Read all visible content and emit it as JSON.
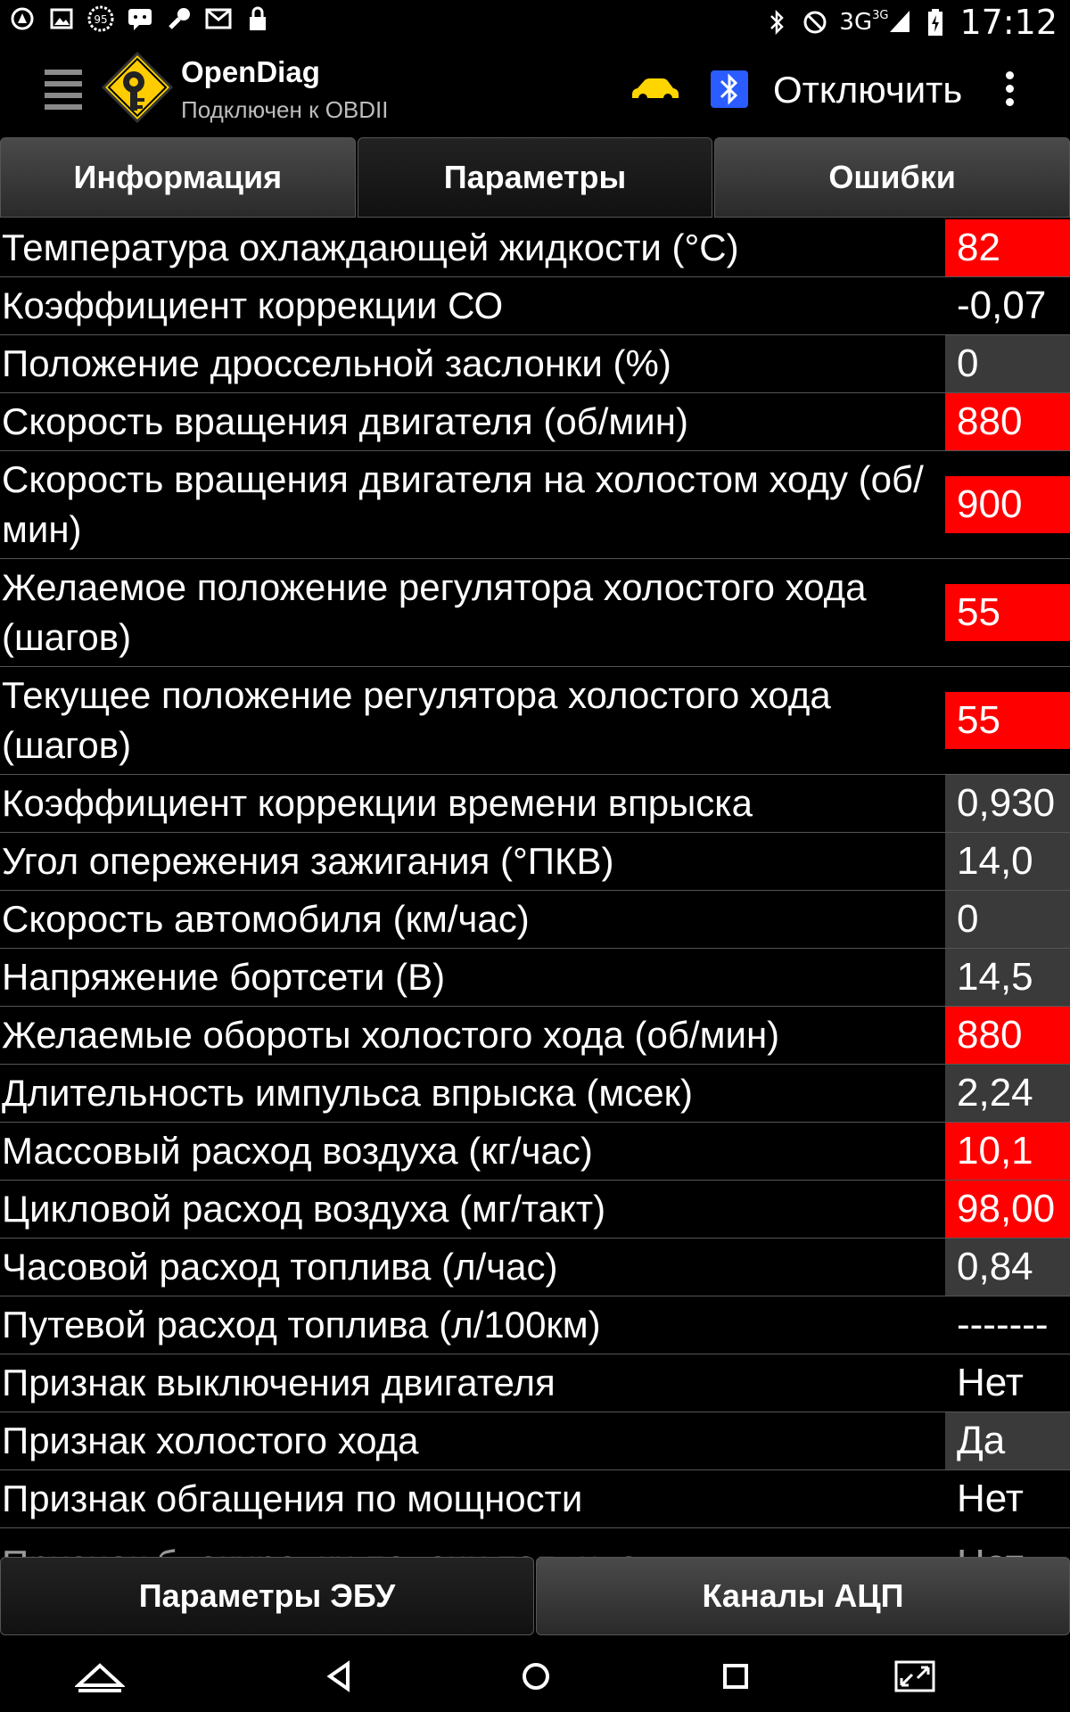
{
  "status_bar": {
    "network": "3G",
    "network_sup": "3G",
    "time": "17:12",
    "badge": "95"
  },
  "app_bar": {
    "title": "OpenDiag",
    "subtitle": "Подключен к OBDII",
    "disconnect_label": "Отключить",
    "car_color": "#ffd500",
    "bt_color": "#2a5cff"
  },
  "tabs": [
    {
      "label": "Информация"
    },
    {
      "label": "Параметры"
    },
    {
      "label": "Ошибки"
    }
  ],
  "parameters": [
    {
      "name": "Температура охлаждающей жидкости (°C)",
      "value": "82",
      "status": "red"
    },
    {
      "name": "Коэффициент коррекции СО",
      "value": "-0,07",
      "status": "black"
    },
    {
      "name": "Положение дроссельной заслонки (%)",
      "value": "0",
      "status": "gray"
    },
    {
      "name": "Скорость вращения двигателя (об/мин)",
      "value": "880",
      "status": "red"
    },
    {
      "name": "Скорость вращения двигателя на холостом ходу (об/мин)",
      "value": "900",
      "status": "red"
    },
    {
      "name": "Желаемое положение регулятора холостого хода (шагов)",
      "value": "55",
      "status": "red"
    },
    {
      "name": "Текущее положение регулятора холостого хода (шагов)",
      "value": "55",
      "status": "red"
    },
    {
      "name": "Коэффициент коррекции времени впрыска",
      "value": "0,930",
      "status": "gray"
    },
    {
      "name": "Угол опережения зажигания (°ПКВ)",
      "value": "14,0",
      "status": "gray"
    },
    {
      "name": "Скорость автомобиля (км/час)",
      "value": "0",
      "status": "gray"
    },
    {
      "name": "Напряжение бортсети (В)",
      "value": "14,5",
      "status": "gray"
    },
    {
      "name": "Желаемые обороты холостого хода (об/мин)",
      "value": "880",
      "status": "red"
    },
    {
      "name": "Длительность импульса впрыска (мсек)",
      "value": "2,24",
      "status": "gray"
    },
    {
      "name": "Массовый расход воздуха (кг/час)",
      "value": "10,1",
      "status": "red"
    },
    {
      "name": "Цикловой расход воздуха (мг/такт)",
      "value": "98,00",
      "status": "red"
    },
    {
      "name": "Часовой расход топлива (л/час)",
      "value": "0,84",
      "status": "gray"
    },
    {
      "name": "Путевой расход топлива (л/100км)",
      "value": "-------",
      "status": "black"
    },
    {
      "name": "Признак выключения двигателя",
      "value": "Нет",
      "status": "black"
    },
    {
      "name": "Признак холостого хода",
      "value": "Да",
      "status": "gray"
    },
    {
      "name": "Признак обгащения по мощности",
      "value": "Нет",
      "status": "black"
    },
    {
      "name": "Признак блокировки подачи топлива",
      "value": "Нет",
      "status": "black"
    }
  ],
  "bottom_tabs": [
    {
      "label": "Параметры ЭБУ"
    },
    {
      "label": "Каналы АЦП"
    }
  ]
}
